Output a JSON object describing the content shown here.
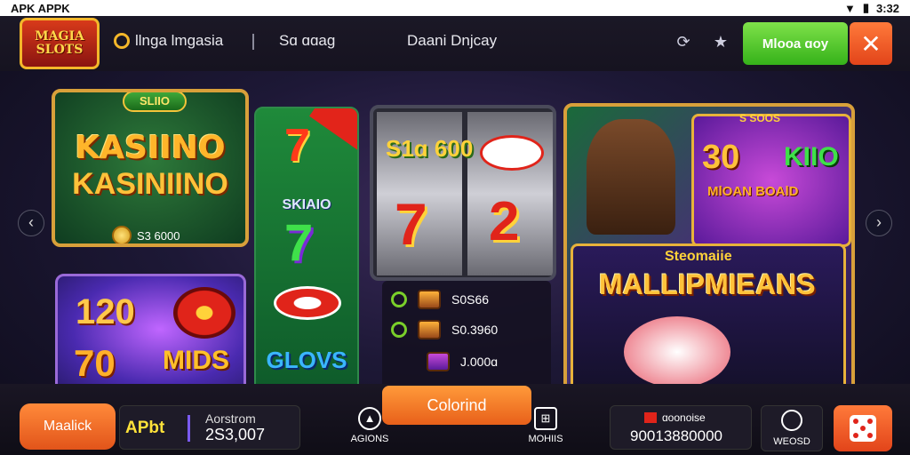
{
  "status_bar": {
    "app_name": "APK APPK",
    "time": "3:32"
  },
  "header": {
    "logo_text": "MAGIA SLOTS",
    "nav": [
      {
        "label": "llnga lmgasia",
        "icon": "chip-icon"
      },
      {
        "label": "Sɑ ɑɑag"
      },
      {
        "label": "Daani Dnjcay"
      }
    ],
    "green_button": "Mlooa ɑoy",
    "close_icon": "✕"
  },
  "tiles": {
    "kasino": {
      "tag": "SLIIO",
      "title1": "KASIINO",
      "title2": "KASINIINO",
      "amount": "S3 6000"
    },
    "promo": {
      "num1": "120",
      "num2": "70",
      "word": "MIDS"
    },
    "green": {
      "label": "SKIAIO",
      "bottom": "GLOVS"
    },
    "slot": {
      "symbol1": "S1ɑ 600"
    },
    "list": [
      {
        "value": "S0S66"
      },
      {
        "value": "S0.3960"
      },
      {
        "value": "J.000ɑ"
      }
    ],
    "big": {
      "tag": "S SOOS",
      "num30": "30",
      "num10": "KIIO",
      "bonus": "MlOAN BOAlD",
      "subtitle": "Steomaiie",
      "title": "MALLIPMIEANS"
    }
  },
  "bottom": {
    "orange_button": "Maalick",
    "info": {
      "code": "APbt",
      "label": "Aorstrom",
      "value": "2Ѕ3,007"
    },
    "center_button": "Colorind",
    "nav1": "AGIONS",
    "nav2": "MOHIIS",
    "bonus": {
      "title": "ɑoonoise",
      "value": "90013880000"
    },
    "webo": "WEOSD"
  }
}
